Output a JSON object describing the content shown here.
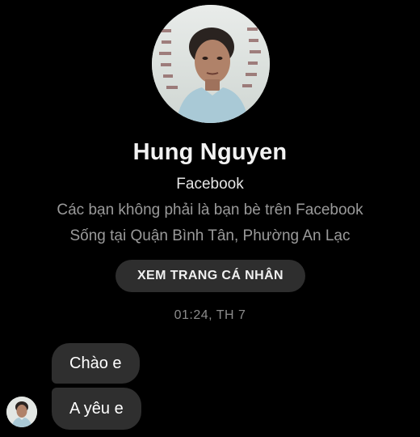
{
  "profile": {
    "name": "Hung Nguyen",
    "platform": "Facebook",
    "friend_status": "Các bạn không phải là bạn bè trên Facebook",
    "location": "Sống tại Quận Bình Tân, Phường An Lạc",
    "view_profile_label": "XEM TRANG CÁ NHÂN",
    "avatar_icon": "profile-photo"
  },
  "conversation": {
    "timestamp": "01:24, TH 7",
    "messages": [
      {
        "text": "Chào e"
      },
      {
        "text": "A yêu e"
      }
    ]
  },
  "colors": {
    "background": "#000000",
    "bubble": "#2f2f2f",
    "button": "#2e2e2e",
    "secondary_text": "#9a9a9a"
  }
}
